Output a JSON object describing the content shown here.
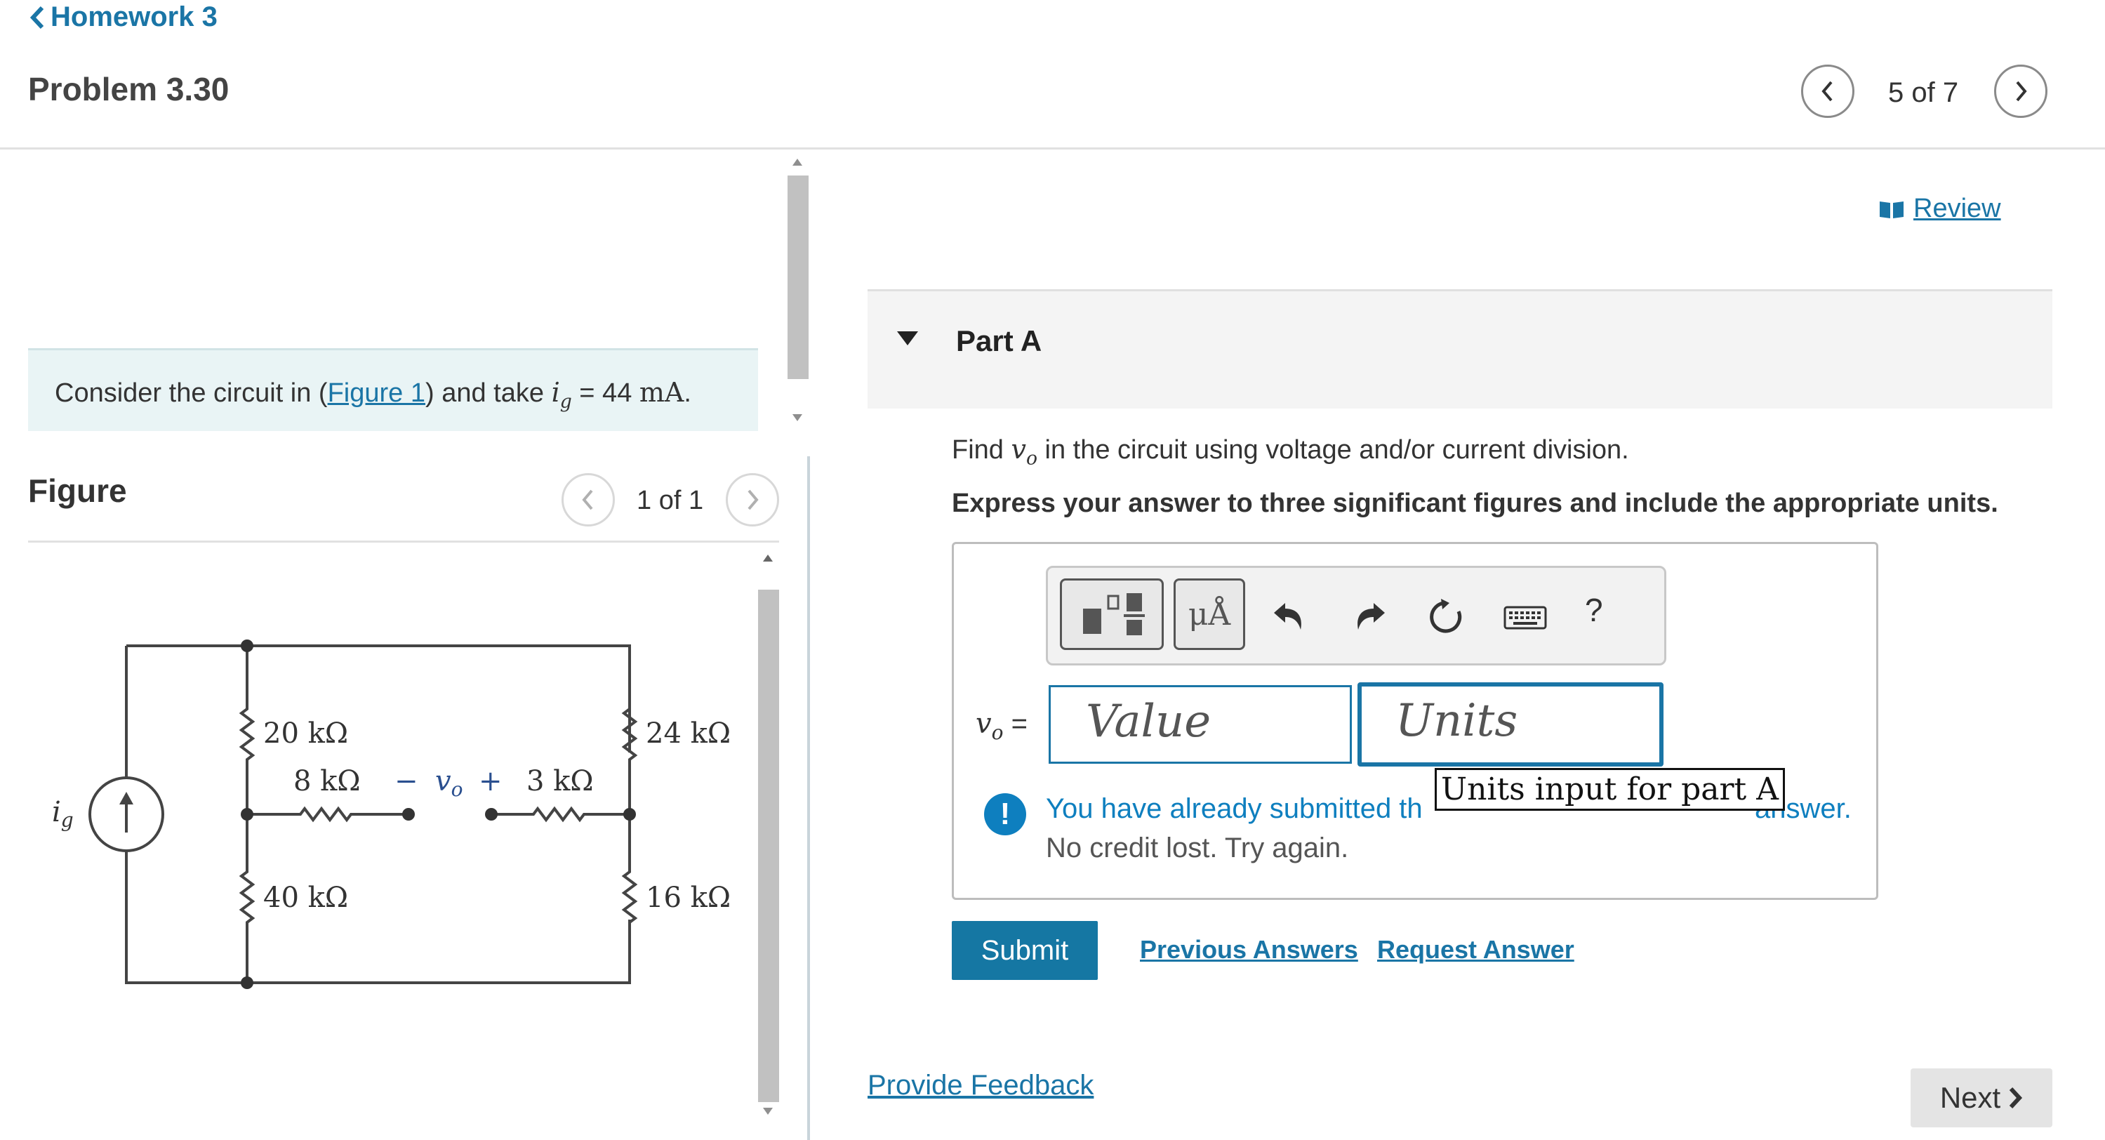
{
  "header": {
    "back_label": "Homework 3",
    "problem_title": "Problem 3.30",
    "pager": "5 of 7"
  },
  "problem": {
    "prefix": "Consider the circuit in (",
    "figure_link": "Figure 1",
    "mid": ") and take ",
    "var": "i",
    "var_sub": "g",
    "equals": " = 44 ",
    "unit": "mA",
    "end": "."
  },
  "figure": {
    "label": "Figure",
    "pager": "1 of 1",
    "circuit_labels": {
      "r20": "20 kΩ",
      "r24": "24 kΩ",
      "r8": "8 kΩ",
      "r3": "3 kΩ",
      "r40": "40 kΩ",
      "r16": "16 kΩ",
      "vo_minus": "−",
      "vo_var": "v",
      "vo_sub": "o",
      "vo_plus": "+",
      "ig_var": "i",
      "ig_sub": "g"
    }
  },
  "review": {
    "label": "Review"
  },
  "part": {
    "title": "Part A",
    "instruction_prefix": "Find ",
    "instruction_var": "v",
    "instruction_sub": "o",
    "instruction_suffix": " in the circuit using voltage and/or current division.",
    "instruction_bold": "Express your answer to three significant figures and include the appropriate units."
  },
  "toolbar": {
    "units_symbol": "μÅ",
    "help": "?"
  },
  "answer": {
    "label_var": "v",
    "label_sub": "o",
    "label_eq": " =",
    "value_placeholder": "Value",
    "units_placeholder": "Units",
    "tooltip": "Units input for part A"
  },
  "feedback": {
    "icon": "!",
    "line1_start": "You have already submitted th",
    "line1_end": "answer.",
    "line2": "No credit lost. Try again."
  },
  "actions": {
    "submit": "Submit",
    "previous_answers": "Previous Answers",
    "request_answer": "Request Answer",
    "provide_feedback": "Provide Feedback",
    "next": "Next"
  },
  "colors": {
    "link": "#1a75a6",
    "submit_bg": "#1577a3",
    "statement_bg": "#e9f4f5",
    "info_icon": "#0e7fbf"
  }
}
